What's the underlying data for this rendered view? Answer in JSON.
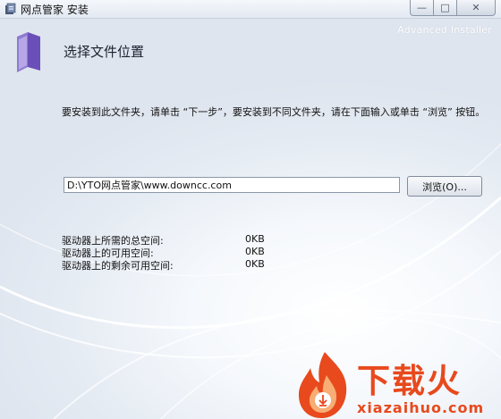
{
  "window": {
    "title": "网点管家 安装",
    "controls": {
      "minimize": "—",
      "maximize": "□",
      "close": "✕"
    }
  },
  "header": {
    "heading": "选择文件位置",
    "watermark": "Advanced Installer",
    "icon": "folder-icon"
  },
  "instructions": "要安装到此文件夹，请单击 “下一步”，要安装到不同文件夹，请在下面输入或单击 “浏览” 按钮。",
  "path": {
    "value": "D:\\YTO网点管家\\www.downcc.com",
    "browse_label": "浏览(O)..."
  },
  "disk_space": [
    {
      "label": "驱动器上所需的总空间:",
      "value": "0KB"
    },
    {
      "label": "驱动器上的可用空间:",
      "value": "0KB"
    },
    {
      "label": "驱动器上的剩余可用空间:",
      "value": "0KB"
    }
  ],
  "logo": {
    "text": "下载火",
    "url_text": "xiazaihuo.com"
  },
  "colors": {
    "brand": "#e8491d",
    "accent": "#6b4fb8"
  }
}
